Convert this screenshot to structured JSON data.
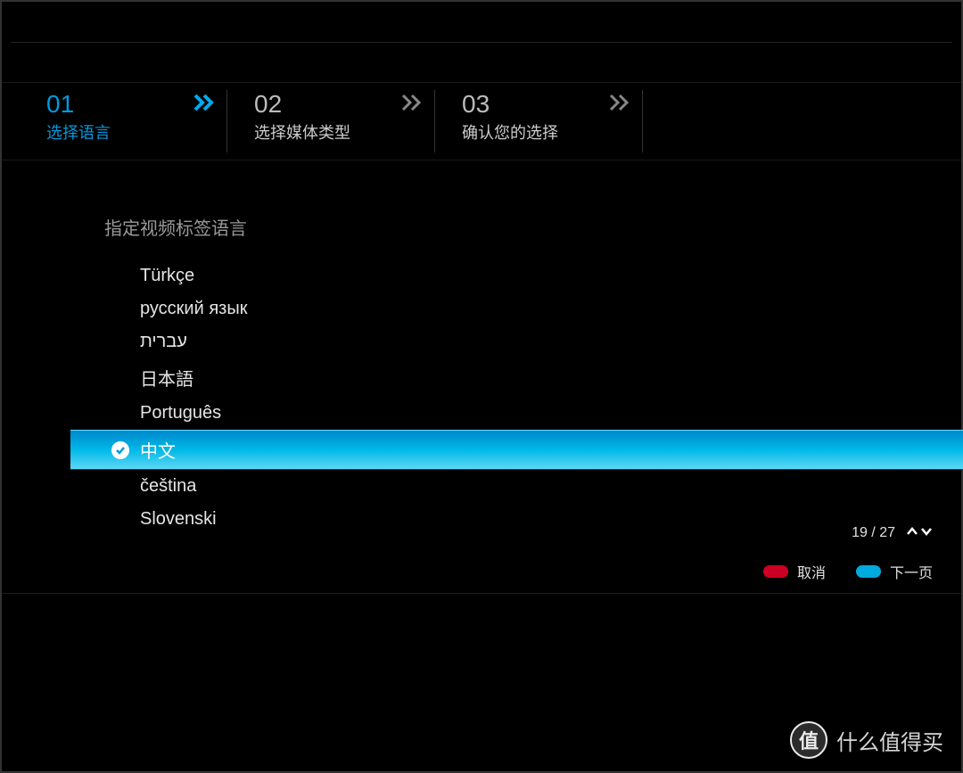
{
  "steps": [
    {
      "number": "01",
      "label": "选择语言",
      "active": true
    },
    {
      "number": "02",
      "label": "选择媒体类型",
      "active": false
    },
    {
      "number": "03",
      "label": "确认您的选择",
      "active": false
    }
  ],
  "content": {
    "heading": "指定视频标签语言",
    "languages": [
      {
        "label": "Türkçe",
        "selected": false
      },
      {
        "label": "русский язык",
        "selected": false
      },
      {
        "label": "עברית",
        "selected": false
      },
      {
        "label": "日本語",
        "selected": false
      },
      {
        "label": "Português",
        "selected": false
      },
      {
        "label": "中文",
        "selected": true
      },
      {
        "label": "čeština",
        "selected": false
      },
      {
        "label": "Slovenski",
        "selected": false
      }
    ]
  },
  "pagination": {
    "current": 19,
    "total": 27,
    "display": "19 / 27"
  },
  "actions": {
    "cancel": {
      "label": "取消",
      "color": "#cc0022"
    },
    "next": {
      "label": "下一页",
      "color": "#00aadd"
    }
  },
  "watermark": {
    "circleText": "值",
    "text": "什么值得买"
  }
}
